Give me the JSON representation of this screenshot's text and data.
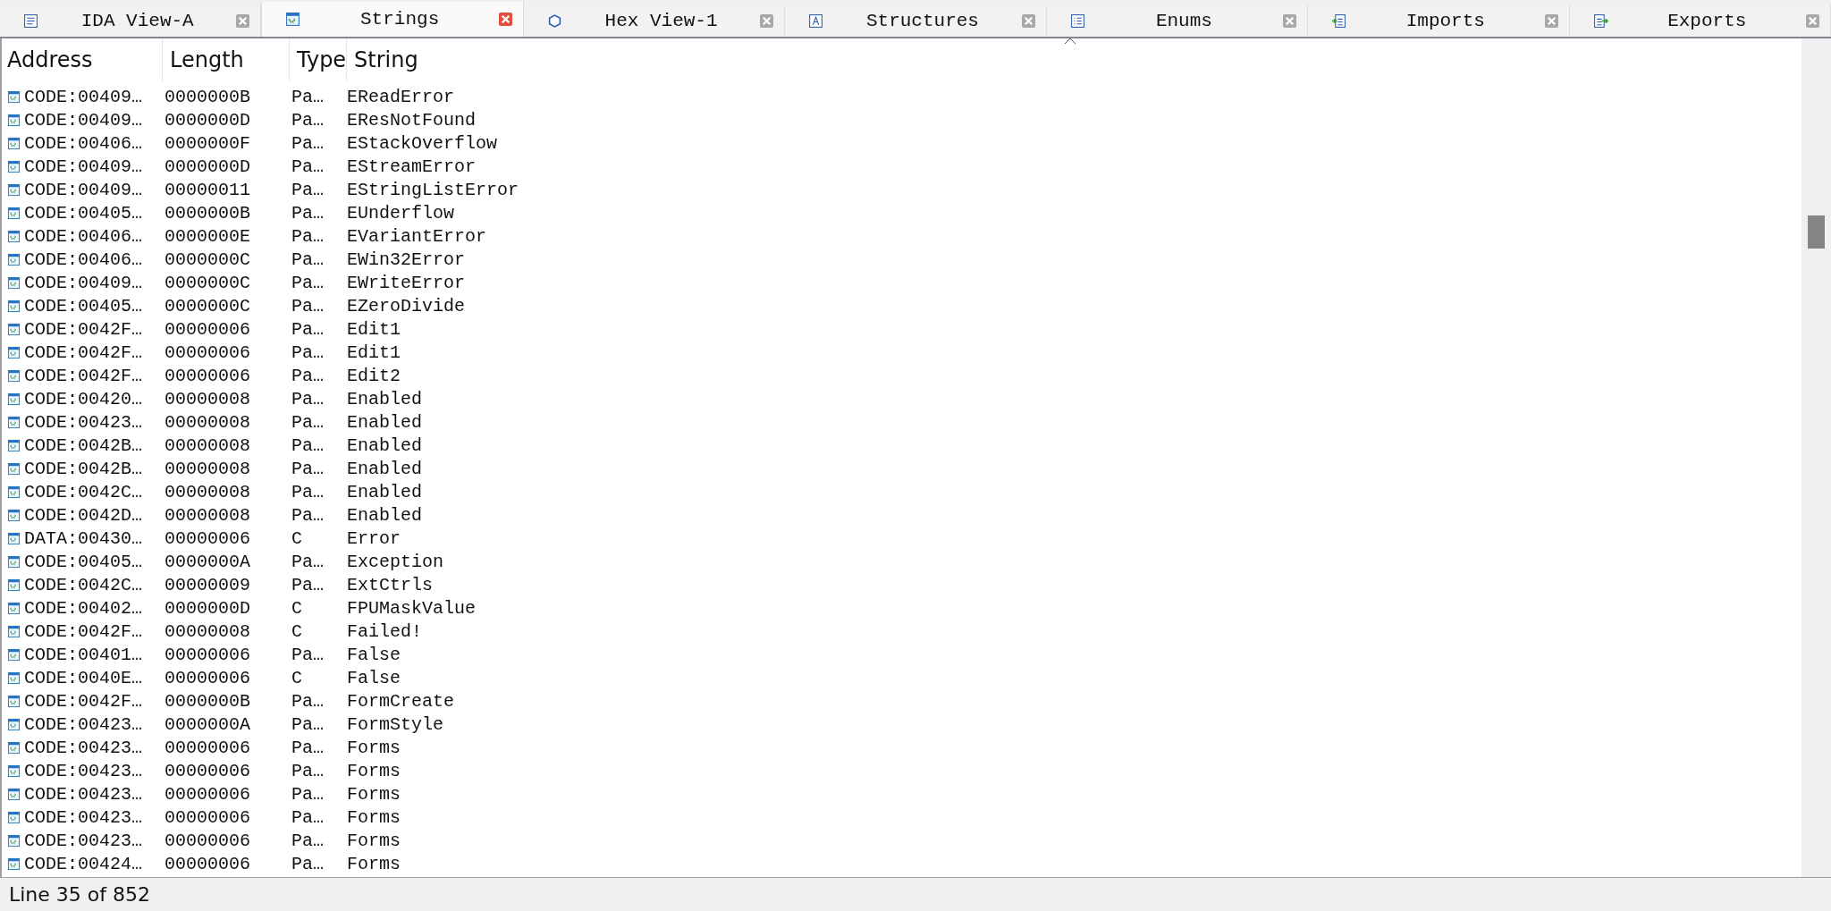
{
  "tabs": [
    {
      "label": "IDA View-A",
      "kind": "listing",
      "selected": false
    },
    {
      "label": "Strings",
      "kind": "strings",
      "selected": true
    },
    {
      "label": "Hex View-1",
      "kind": "hex",
      "selected": false
    },
    {
      "label": "Structures",
      "kind": "structs",
      "selected": false
    },
    {
      "label": "Enums",
      "kind": "enums",
      "selected": false
    },
    {
      "label": "Imports",
      "kind": "imports",
      "selected": false
    },
    {
      "label": "Exports",
      "kind": "exports",
      "selected": false
    }
  ],
  "table": {
    "columns": [
      "Address",
      "Length",
      "Type",
      "String"
    ],
    "rows": [
      [
        "CODE:00409…",
        "0000000B",
        "Pa…",
        "EReadError"
      ],
      [
        "CODE:00409…",
        "0000000D",
        "Pa…",
        "EResNotFound"
      ],
      [
        "CODE:00406…",
        "0000000F",
        "Pa…",
        "EStackOverflow"
      ],
      [
        "CODE:00409…",
        "0000000D",
        "Pa…",
        "EStreamError"
      ],
      [
        "CODE:00409…",
        "00000011",
        "Pa…",
        "EStringListError"
      ],
      [
        "CODE:00405…",
        "0000000B",
        "Pa…",
        "EUnderflow"
      ],
      [
        "CODE:00406…",
        "0000000E",
        "Pa…",
        "EVariantError"
      ],
      [
        "CODE:00406…",
        "0000000C",
        "Pa…",
        "EWin32Error"
      ],
      [
        "CODE:00409…",
        "0000000C",
        "Pa…",
        "EWriteError"
      ],
      [
        "CODE:00405…",
        "0000000C",
        "Pa…",
        "EZeroDivide"
      ],
      [
        "CODE:0042F…",
        "00000006",
        "Pa…",
        "Edit1"
      ],
      [
        "CODE:0042F…",
        "00000006",
        "Pa…",
        "Edit1"
      ],
      [
        "CODE:0042F…",
        "00000006",
        "Pa…",
        "Edit2"
      ],
      [
        "CODE:00420…",
        "00000008",
        "Pa…",
        "Enabled"
      ],
      [
        "CODE:00423…",
        "00000008",
        "Pa…",
        "Enabled"
      ],
      [
        "CODE:0042B…",
        "00000008",
        "Pa…",
        "Enabled"
      ],
      [
        "CODE:0042B…",
        "00000008",
        "Pa…",
        "Enabled"
      ],
      [
        "CODE:0042C…",
        "00000008",
        "Pa…",
        "Enabled"
      ],
      [
        "CODE:0042D…",
        "00000008",
        "Pa…",
        "Enabled"
      ],
      [
        "DATA:00430…",
        "00000006",
        "C",
        "Error"
      ],
      [
        "CODE:00405…",
        "0000000A",
        "Pa…",
        "Exception"
      ],
      [
        "CODE:0042C…",
        "00000009",
        "Pa…",
        "ExtCtrls"
      ],
      [
        "CODE:00402…",
        "0000000D",
        "C",
        "FPUMaskValue"
      ],
      [
        "CODE:0042F…",
        "00000008",
        "C",
        "Failed!"
      ],
      [
        "CODE:00401…",
        "00000006",
        "Pa…",
        "False"
      ],
      [
        "CODE:0040E…",
        "00000006",
        "C",
        "False"
      ],
      [
        "CODE:0042F…",
        "0000000B",
        "Pa…",
        "FormCreate"
      ],
      [
        "CODE:00423…",
        "0000000A",
        "Pa…",
        "FormStyle"
      ],
      [
        "CODE:00423…",
        "00000006",
        "Pa…",
        "Forms"
      ],
      [
        "CODE:00423…",
        "00000006",
        "Pa…",
        "Forms"
      ],
      [
        "CODE:00423…",
        "00000006",
        "Pa…",
        "Forms"
      ],
      [
        "CODE:00423…",
        "00000006",
        "Pa…",
        "Forms"
      ],
      [
        "CODE:00423…",
        "00000006",
        "Pa…",
        "Forms"
      ],
      [
        "CODE:00424…",
        "00000006",
        "Pa…",
        "Forms"
      ]
    ]
  },
  "status_bar": "Line 35 of 852"
}
